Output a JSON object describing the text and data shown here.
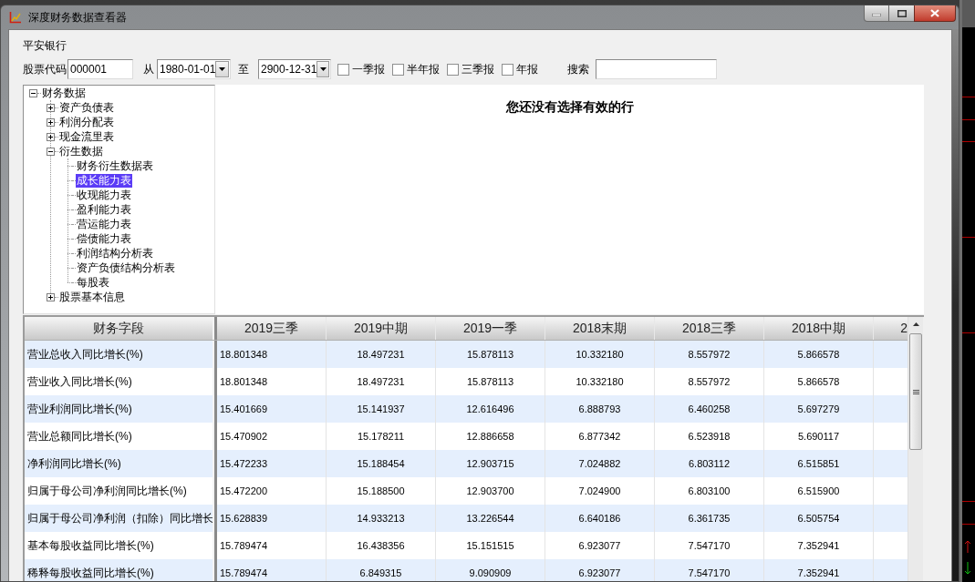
{
  "window": {
    "title": "深度财务数据查看器"
  },
  "company": "平安银行",
  "filters": {
    "stock_code": {
      "label": "股票代码",
      "value": "000001"
    },
    "date_from": {
      "label": "从",
      "value": "1980-01-01"
    },
    "date_to": {
      "label": "至",
      "value": "2900-12-31"
    },
    "report_types": [
      {
        "label": "一季报",
        "checked": false
      },
      {
        "label": "半年报",
        "checked": false
      },
      {
        "label": "三季报",
        "checked": false
      },
      {
        "label": "年报",
        "checked": false
      }
    ],
    "search": {
      "label": "搜索"
    }
  },
  "tree": [
    {
      "label": "财务数据",
      "expanded": true,
      "selected": false,
      "children": [
        {
          "label": "资产负债表",
          "expanded": false,
          "selected": false
        },
        {
          "label": "利润分配表",
          "expanded": false,
          "selected": false
        },
        {
          "label": "现金流里表",
          "expanded": false,
          "selected": false
        },
        {
          "label": "衍生数据",
          "expanded": true,
          "selected": false,
          "children": [
            {
              "label": "财务衍生数据表",
              "selected": false
            },
            {
              "label": "成长能力表",
              "selected": true
            },
            {
              "label": "收现能力表",
              "selected": false
            },
            {
              "label": "盈利能力表",
              "selected": false
            },
            {
              "label": "营运能力表",
              "selected": false
            },
            {
              "label": "偿债能力表",
              "selected": false
            },
            {
              "label": "利润结构分析表",
              "selected": false
            },
            {
              "label": "资产负债结构分析表",
              "selected": false
            },
            {
              "label": "每股表",
              "selected": false
            }
          ]
        },
        {
          "label": "股票基本信息",
          "expanded": false,
          "selected": false
        }
      ]
    }
  ],
  "message": "您还没有选择有效的行",
  "table": {
    "columns": [
      "财务字段",
      "2019三季",
      "2019中期",
      "2019一季",
      "2018末期",
      "2018三季",
      "2018中期",
      "2"
    ],
    "rows": [
      {
        "field": "营业总收入同比增长(%)",
        "values": [
          "18.801348",
          "18.497231",
          "15.878113",
          "10.332180",
          "8.557972",
          "5.866578"
        ]
      },
      {
        "field": "营业收入同比增长(%)",
        "values": [
          "18.801348",
          "18.497231",
          "15.878113",
          "10.332180",
          "8.557972",
          "5.866578"
        ]
      },
      {
        "field": "营业利润同比增长(%)",
        "values": [
          "15.401669",
          "15.141937",
          "12.616496",
          "6.888793",
          "6.460258",
          "5.697279"
        ]
      },
      {
        "field": "营业总额同比增长(%)",
        "values": [
          "15.470902",
          "15.178211",
          "12.886658",
          "6.877342",
          "6.523918",
          "5.690117"
        ]
      },
      {
        "field": "净利润同比增长(%)",
        "values": [
          "15.472233",
          "15.188454",
          "12.903715",
          "7.024882",
          "6.803112",
          "6.515851"
        ]
      },
      {
        "field": "归属于母公司净利润同比增长(%)",
        "values": [
          "15.472200",
          "15.188500",
          "12.903700",
          "7.024900",
          "6.803100",
          "6.515900"
        ]
      },
      {
        "field": "归属于母公司净利润（扣除）同比增长",
        "values": [
          "15.628839",
          "14.933213",
          "13.226544",
          "6.640186",
          "6.361735",
          "6.505754"
        ]
      },
      {
        "field": "基本每股收益同比增长(%)",
        "values": [
          "15.789474",
          "16.438356",
          "15.151515",
          "6.923077",
          "7.547170",
          "7.352941"
        ]
      },
      {
        "field": "稀释每股收益同比增长(%)",
        "values": [
          "15.789474",
          "6.849315",
          "9.090909",
          "6.923077",
          "7.547170",
          "7.352941"
        ]
      }
    ]
  }
}
